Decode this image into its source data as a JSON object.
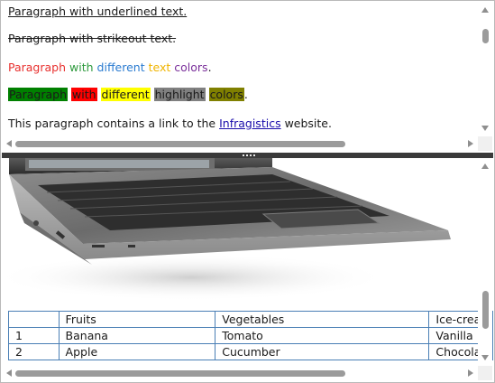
{
  "document": {
    "underlined": "Paragraph with underlined text.",
    "strikeout": "Paragraph with strikeout text.",
    "colors": {
      "words": [
        {
          "text": "Paragraph",
          "color": "#e8312f"
        },
        {
          "text": "with",
          "color": "#2e9a3d"
        },
        {
          "text": "different",
          "color": "#2a7bd0"
        },
        {
          "text": "text",
          "color": "#f0b400"
        },
        {
          "text": "colors",
          "color": "#7a2f9a"
        }
      ],
      "period": "."
    },
    "highlights": {
      "words": [
        {
          "text": "Paragraph",
          "bg": "#008000"
        },
        {
          "text": "with",
          "bg": "#ff0000"
        },
        {
          "text": "different",
          "bg": "#ffff00"
        },
        {
          "text": "highlight",
          "bg": "#808080"
        },
        {
          "text": "colors",
          "bg": "#808000"
        }
      ],
      "period": "."
    },
    "link_paragraph": {
      "before": "This paragraph contains a link to the ",
      "link": "Infragistics",
      "after": " website."
    }
  },
  "table": {
    "header": [
      "",
      "Fruits",
      "Vegetables",
      "Ice-cream"
    ],
    "rows": [
      [
        "1",
        "Banana",
        "Tomato",
        "Vanilla"
      ],
      [
        "2",
        "Apple",
        "Cucumber",
        "Chocolate"
      ]
    ]
  },
  "colors": {
    "table_border": "#4a7fb5",
    "splitter": "#3a3a3a",
    "scrollbar_thumb": "#9b9b9b"
  }
}
